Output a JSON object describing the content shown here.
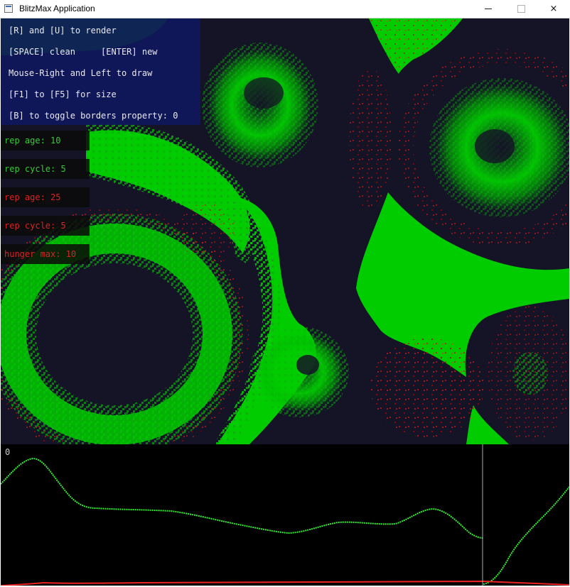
{
  "window": {
    "title": "BlitzMax Application",
    "controls": {
      "minimize": "minimize",
      "maximize": "maximize",
      "close": "×"
    }
  },
  "help": {
    "lines": [
      "[R] and [U] to render",
      "[SPACE] clean     [ENTER] new",
      "Mouse-Right and Left to draw",
      "[F1] to [F5] for size",
      "[B] to toggle borders property: 0"
    ]
  },
  "params": [
    {
      "label": "rep age: 10",
      "color": "#33cc33"
    },
    {
      "label": "rep cycle: 5",
      "color": "#33cc33"
    },
    {
      "label": "rep age: 25",
      "color": "#dd2222"
    },
    {
      "label": "rep cycle: 5",
      "color": "#dd2222"
    },
    {
      "label": "hunger max: 10",
      "color": "#dd2222"
    }
  ],
  "colors": {
    "background": "#141426",
    "prey": "#00cc00",
    "predator": "#cc0000",
    "graph_prey": "#33ee33",
    "graph_predator": "#ee2222",
    "cursor_line": "#aaaaaa"
  },
  "graph": {
    "label": "0",
    "cursor_fraction": 0.848
  }
}
